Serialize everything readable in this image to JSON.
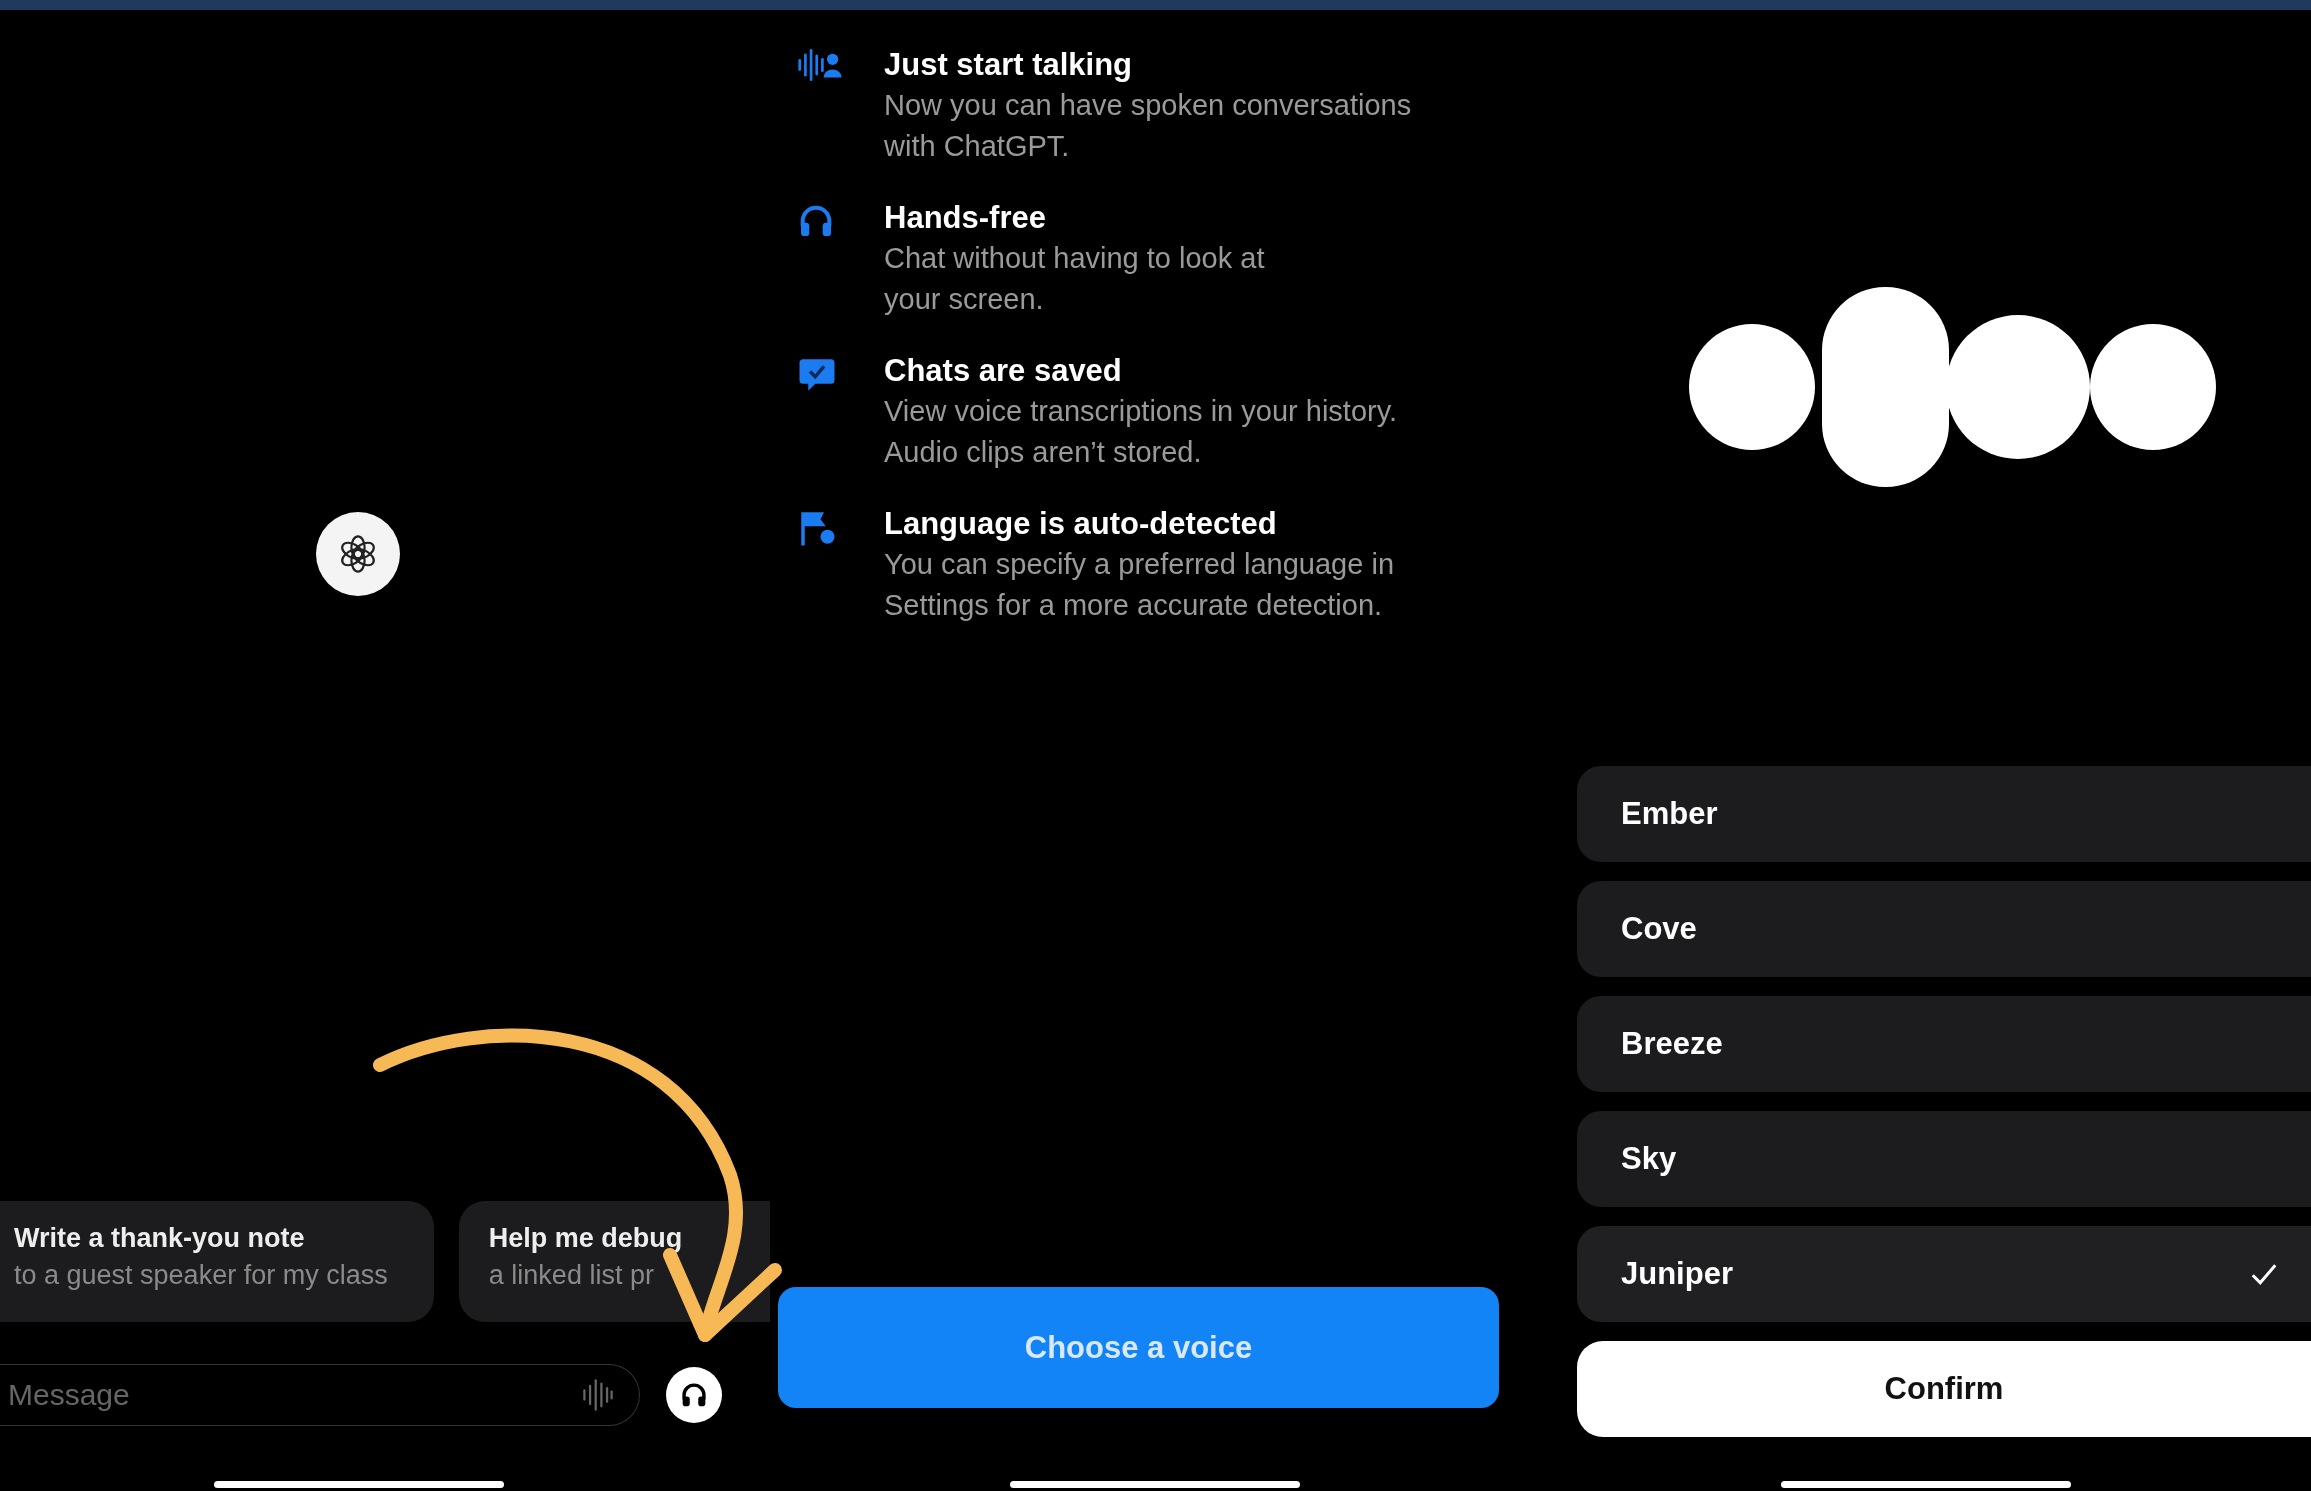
{
  "chat_screen": {
    "suggestions": [
      {
        "title": "Write a thank-you note",
        "subtitle": "to a guest speaker for my class"
      },
      {
        "title": "Help me debug",
        "subtitle": "a linked list pr"
      }
    ],
    "message_field": {
      "placeholder": "Message"
    }
  },
  "voice_intro_screen": {
    "features": [
      {
        "kind": "voice",
        "title": "Just start talking",
        "description": "Now you can have spoken conversations with ChatGPT."
      },
      {
        "kind": "headphones",
        "title": "Hands-free",
        "description": "Chat without having to look at your screen."
      },
      {
        "kind": "saved",
        "title": "Chats are saved",
        "description": "View voice transcriptions in your history. Audio clips aren’t stored."
      },
      {
        "kind": "language",
        "title": "Language is auto-detected",
        "description": "You can specify a preferred language in Settings for a more accurate detection."
      }
    ],
    "button": "Choose a voice"
  },
  "voice_picker_screen": {
    "voices": [
      {
        "name": "Ember",
        "selected": false
      },
      {
        "name": "Cove",
        "selected": false
      },
      {
        "name": "Breeze",
        "selected": false
      },
      {
        "name": "Sky",
        "selected": false
      },
      {
        "name": "Juniper",
        "selected": true
      }
    ],
    "confirm_button": "Confirm"
  }
}
